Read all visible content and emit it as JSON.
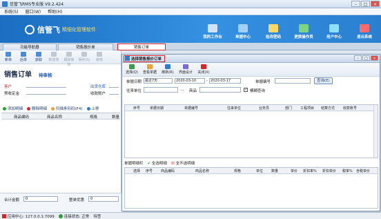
{
  "app": {
    "title": "信管飞RMS专业版 V9.2.424"
  },
  "menu": [
    "系统(S)",
    "窗口(W)",
    "帮助(H)"
  ],
  "banner": {
    "brand": "信管飞",
    "slogan": "精细化管理软件"
  },
  "topnav": [
    {
      "label": "我的工作台",
      "color": "#cfe3ff"
    },
    {
      "label": "单据中心",
      "color": "#9fd0ff"
    },
    {
      "label": "检改密码",
      "color": "#ffd966"
    },
    {
      "label": "更换操作员",
      "color": "#7fd47f"
    },
    {
      "label": "用户中心",
      "color": "#8fe0ff"
    },
    {
      "label": "退出系统",
      "color": "#ff6b6b"
    }
  ],
  "tabs": [
    "功能导航器",
    "销售报价单",
    "销售订单"
  ],
  "toolbar": [
    "新单",
    "后单",
    "获取",
    "新增单",
    "跟踪审核",
    "保存(S)",
    "审核"
  ],
  "order": {
    "title": "销售订单",
    "status": "待审核",
    "customer_label": "客户",
    "warehouse_label": "出货仓库",
    "prepaid_label": "预收定金",
    "account_label": "收款账户"
  },
  "line_buttons": [
    "添加明细",
    "删除明细",
    "扫描条形码(F4)",
    "上移"
  ],
  "left_grid": {
    "headers": [
      "商品编码",
      "商品名称",
      "规格",
      "数量"
    ]
  },
  "footer": {
    "total_label": "合计金额",
    "total_value": "0",
    "discount_label": "整单优惠",
    "discount_value": "0"
  },
  "status": {
    "app_center": "应用中心: 127.0.0.1:7099",
    "connection": "连接状态: 正常",
    "extra": "待签"
  },
  "dialog": {
    "title": "选择销售报价订单",
    "tools": [
      "选择(Q)",
      "查看单据",
      "刷新(R)",
      "界面设计",
      "关闭(X)"
    ],
    "criteria": {
      "date_label": "单据日期",
      "date_range": "最近7天",
      "date_from": "2020-03-10",
      "date_to": "2020-03-17",
      "docno_label": "单据编号",
      "query_button": "查询(E)",
      "party_label": "往来单位",
      "goods_label": "商品",
      "fuzzy_label": "模糊查询"
    },
    "grid1_headers": [
      "序号",
      "单据日期",
      "单据编号",
      "往来单位",
      "业务员",
      "部门",
      "工程项目",
      "结算方式",
      "收款账号"
    ],
    "detail_tab": "单据明细栏",
    "select_all": "全选明细",
    "deselect_all": "全不选明细",
    "grid2_headers": [
      "选择",
      "序号",
      "商品编码",
      "商品名称",
      "规格",
      "单位",
      "数量",
      "单价",
      "折扣率%",
      "折扣单价",
      "税率%",
      "含税单价"
    ]
  }
}
